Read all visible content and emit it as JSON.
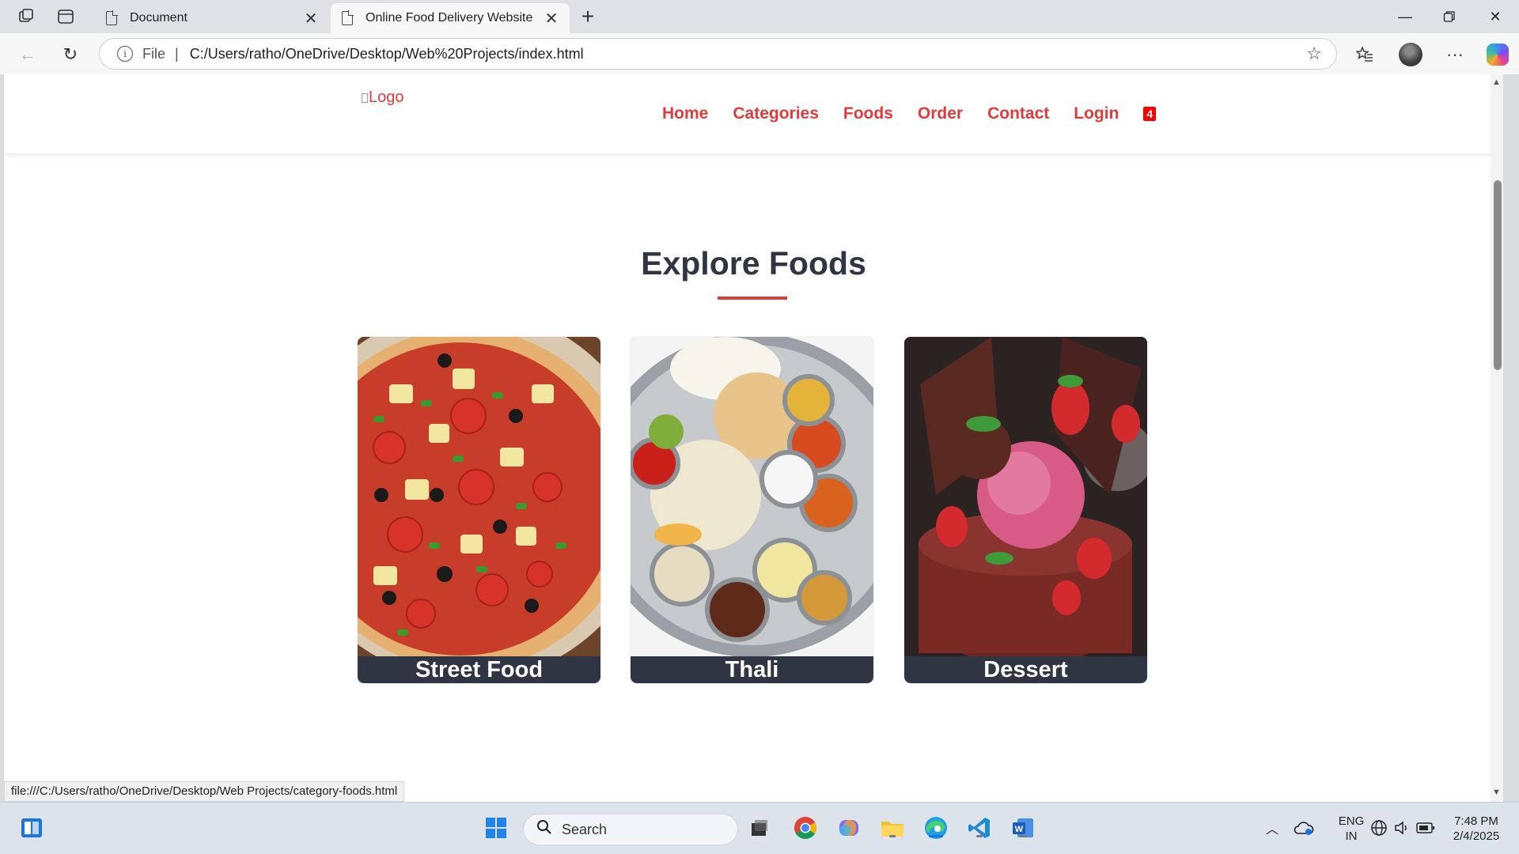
{
  "browser": {
    "tabs": [
      {
        "label": "Document"
      },
      {
        "label": "Online Food Delivery Website"
      }
    ],
    "address": {
      "scheme_label": "File",
      "url": "C:/Users/ratho/OneDrive/Desktop/Web%20Projects/index.html"
    },
    "status_link": "file:///C:/Users/ratho/OneDrive/Desktop/Web Projects/category-foods.html"
  },
  "site": {
    "logo_alt": "Logo",
    "nav": [
      "Home",
      "Categories",
      "Foods",
      "Order",
      "Contact",
      "Login"
    ],
    "cart_count": "4",
    "section_title": "Explore Foods",
    "categories": [
      {
        "name": "Street Food"
      },
      {
        "name": "Thali"
      },
      {
        "name": "Dessert"
      }
    ],
    "colors": {
      "accent": "#e03b3b",
      "heading": "#2f3542",
      "caption_bg": "#2f3542"
    }
  },
  "taskbar": {
    "search_placeholder": "Search",
    "lang_top": "ENG",
    "lang_bottom": "IN",
    "time": "7:48 PM",
    "date": "2/4/2025"
  }
}
